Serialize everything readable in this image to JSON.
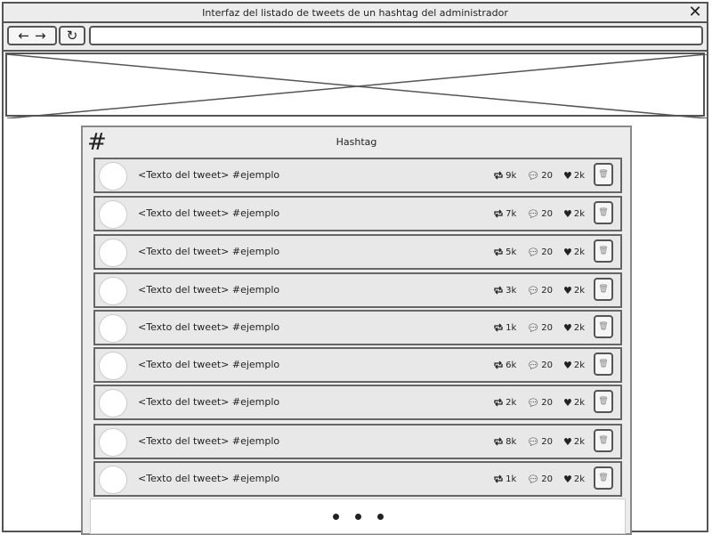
{
  "window": {
    "title": "Interfaz del listado de tweets de un hashtag del administrador"
  },
  "toolbar": {
    "back_icon": "←",
    "forward_icon": "→",
    "reload_icon": "C",
    "url": ""
  },
  "panel": {
    "title": "Hashtag",
    "hash_symbol": "#"
  },
  "tweets": [
    {
      "text": "<Texto del tweet> #ejemplo",
      "retweets": "9k",
      "comments": "20",
      "likes": "2k"
    },
    {
      "text": "<Texto del tweet> #ejemplo",
      "retweets": "7k",
      "comments": "20",
      "likes": "2k"
    },
    {
      "text": "<Texto del tweet> #ejemplo",
      "retweets": "5k",
      "comments": "20",
      "likes": "2k"
    },
    {
      "text": "<Texto del tweet> #ejemplo",
      "retweets": "3k",
      "comments": "20",
      "likes": "2k"
    },
    {
      "text": "<Texto del tweet> #ejemplo",
      "retweets": "1k",
      "comments": "20",
      "likes": "2k"
    },
    {
      "text": "<Texto del tweet> #ejemplo",
      "retweets": "6k",
      "comments": "20",
      "likes": "2k"
    },
    {
      "text": "<Texto del tweet> #ejemplo",
      "retweets": "2k",
      "comments": "20",
      "likes": "2k"
    },
    {
      "text": "<Texto del tweet> #ejemplo",
      "retweets": "8k",
      "comments": "20",
      "likes": "2k"
    },
    {
      "text": "<Texto del tweet> #ejemplo",
      "retweets": "1k",
      "comments": "20",
      "likes": "2k"
    }
  ],
  "icons": {
    "retweet": "retweet-icon",
    "comment": "comment-icon",
    "like": "heart-icon",
    "delete": "trash-icon"
  }
}
